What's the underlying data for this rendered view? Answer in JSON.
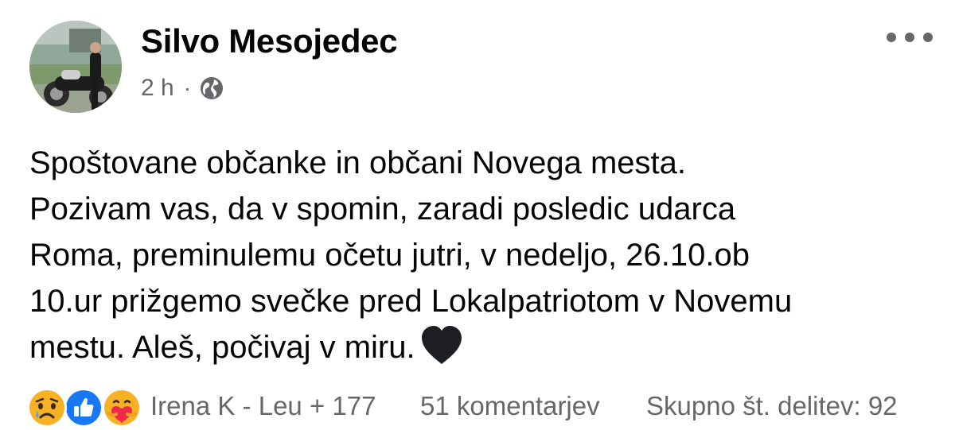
{
  "post": {
    "author": "Silvo Mesojedec",
    "time": "2 h",
    "separator": "·",
    "privacy_icon": "globe-icon",
    "text_lines": [
      "Spoštovane občanke in občani Novega mesta.",
      "Pozivam vas, da v spomin, zaradi posledic udarca",
      "Roma, preminulemu očetu jutri, v nedeljo, 26.10.ob",
      "10.ur prižgemo svečke pred Lokalpatriotom v Novemu",
      "mestu. Aleš, počivaj v miru."
    ],
    "trailing_emoji": "black-heart-icon"
  },
  "footer": {
    "reactions": [
      "sad-reaction-icon",
      "like-reaction-icon",
      "care-reaction-icon"
    ],
    "reactors": "Irena K - Leu + 177",
    "comments": "51 komentarjev",
    "shares": "Skupno št. delitev: 92"
  },
  "colors": {
    "text": "#050505",
    "secondary": "#65676b",
    "like_blue": "#1877f2",
    "reaction_yellow": "#f7b125",
    "care_red": "#f02849",
    "heart": "#1c1e21"
  }
}
